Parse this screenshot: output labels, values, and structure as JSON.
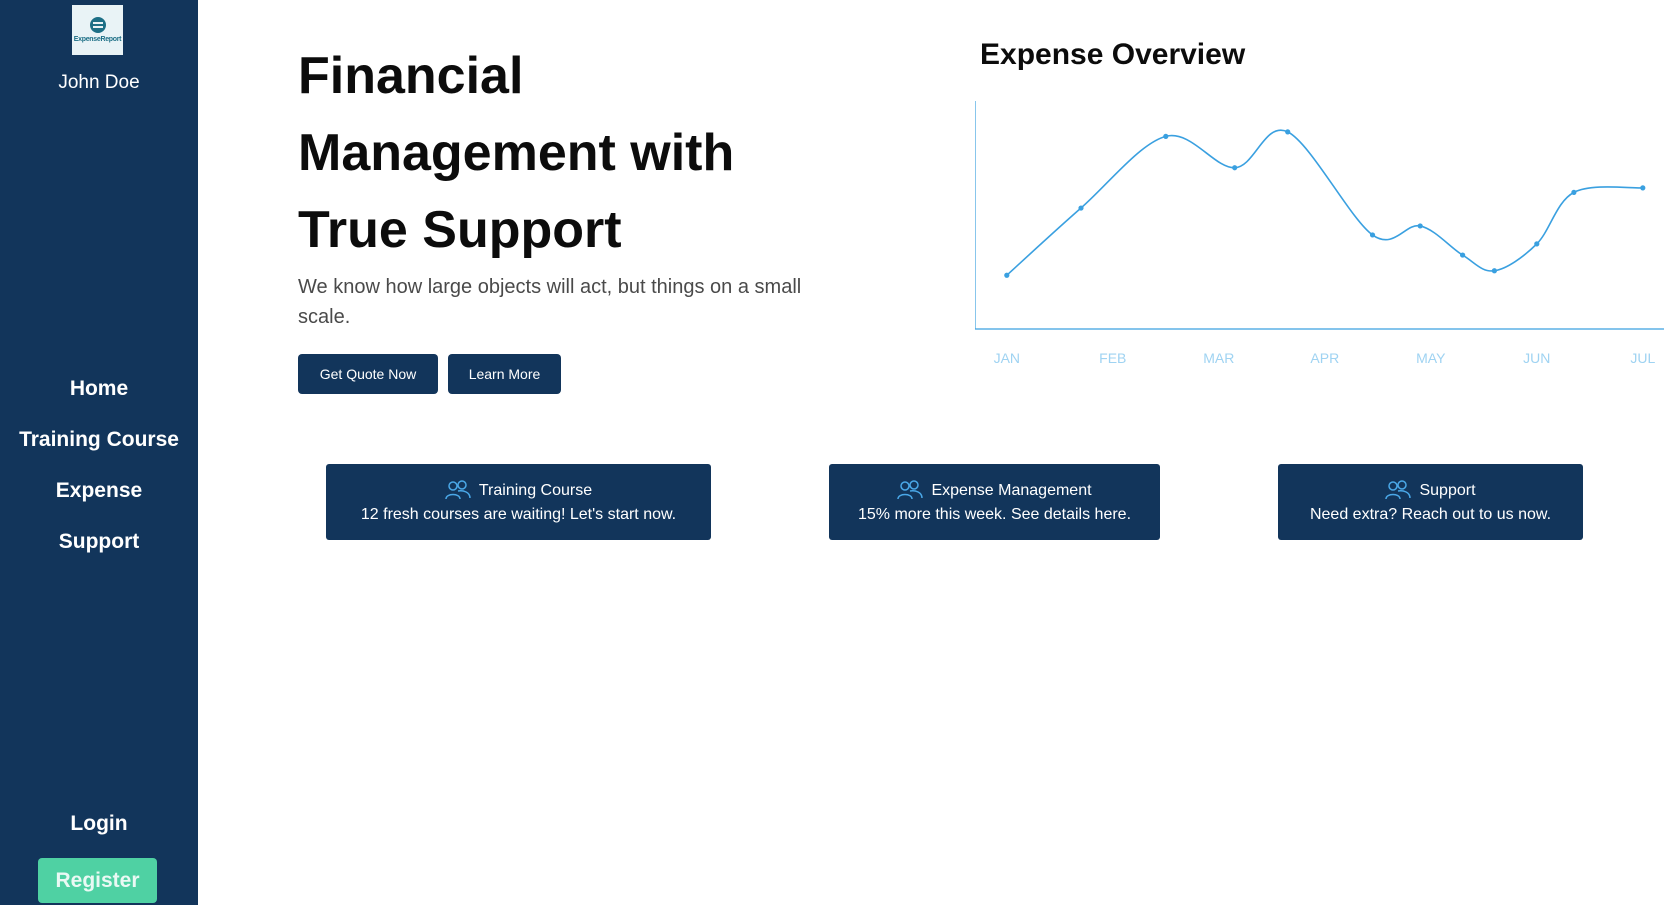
{
  "sidebar": {
    "logo_text": "ExpenseReport",
    "user_name": "John Doe",
    "nav": [
      {
        "label": "Home"
      },
      {
        "label": "Training Course"
      },
      {
        "label": "Expense"
      },
      {
        "label": "Support"
      }
    ],
    "login_label": "Login",
    "register_label": "Register"
  },
  "hero": {
    "title_line1": "Financial",
    "title_line2": "Management with",
    "title_line3": "True Support",
    "subtitle": "We know how large objects will act, but things on a small scale.",
    "quote_button": "Get Quote Now",
    "learn_button": "Learn More"
  },
  "cards": [
    {
      "icon": "users-icon",
      "title": "Training Course",
      "description": "12 fresh courses are waiting! Let's start now."
    },
    {
      "icon": "users-icon",
      "title": "Expense Management",
      "description": "15% more this week. See details here."
    },
    {
      "icon": "users-icon",
      "title": "Support",
      "description": "Need extra? Reach out to us now."
    }
  ],
  "colors": {
    "sidebar_bg": "#12355b",
    "button_bg": "#12355b",
    "register_bg": "#4fd1a3",
    "chart_line": "#3aa0e0",
    "chart_axis_label": "#9fd3f2"
  },
  "chart_data": {
    "type": "line",
    "title": "Expense Overview",
    "categories": [
      "JAN",
      "FEB",
      "MAR",
      "APR",
      "MAY",
      "JUN",
      "JUL"
    ],
    "x": [
      0.0,
      0.7,
      1.5,
      2.15,
      2.65,
      3.45,
      3.9,
      4.3,
      4.6,
      5.0,
      5.35,
      6.0
    ],
    "y": [
      0.24,
      0.54,
      0.86,
      0.72,
      0.88,
      0.42,
      0.46,
      0.33,
      0.26,
      0.38,
      0.61,
      0.63
    ],
    "xlim": [
      -0.3,
      6.2
    ],
    "ylim": [
      0,
      1
    ],
    "grid": false,
    "legend": "none"
  }
}
